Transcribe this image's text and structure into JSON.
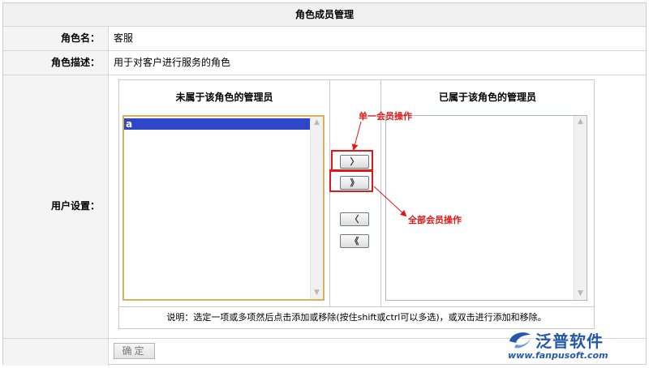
{
  "title": "角色成员管理",
  "role_name": {
    "label": "角色名：",
    "value": "客服"
  },
  "role_desc": {
    "label": "角色描述：",
    "value": "用于对客户进行服务的角色"
  },
  "user_settings": {
    "label": "用户设置：",
    "left_title": "未属于该角色的管理员",
    "right_title": "已属于该角色的管理员",
    "left_options": [
      "a"
    ],
    "selected_option": "a",
    "right_options": [],
    "buttons": {
      "move_one_right": "〉",
      "move_all_right": "》",
      "move_one_left": "〈",
      "move_all_left": "《"
    },
    "note": "说明：选定一项或多项然后点击添加或移除(按住shift或ctrl可以多选)，或双击进行添加和移除。"
  },
  "annotations": {
    "single": "单一会员操作",
    "all": "全部会员操作"
  },
  "confirm_label": "确定",
  "logo": {
    "text": "泛普软件",
    "url": "www.fanpusoft.com"
  },
  "colors": {
    "annotation_red": "#e01818",
    "selected_blue": "#2d47c8",
    "logo_blue": "#2359a8"
  }
}
